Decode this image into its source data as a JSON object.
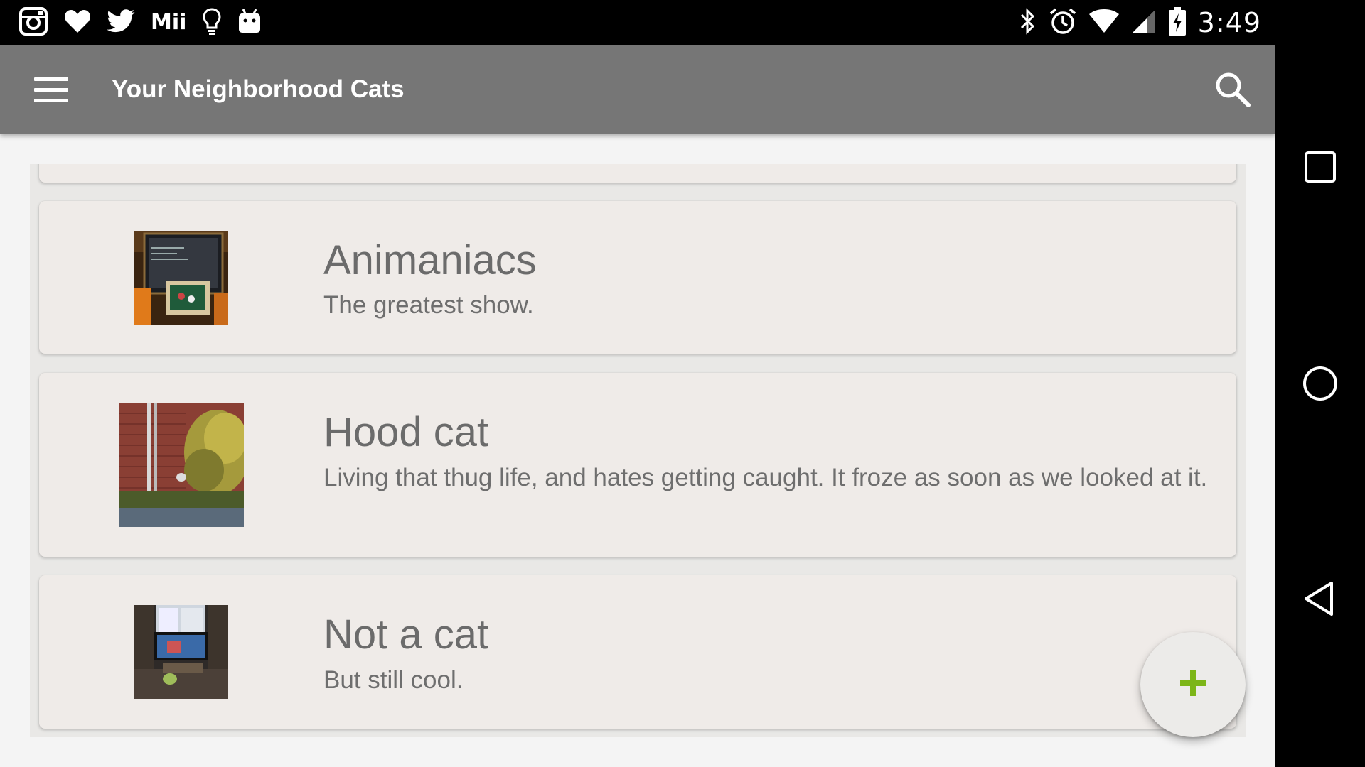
{
  "status_bar": {
    "left_icons": [
      "instagram-icon",
      "heart-icon",
      "twitter-icon",
      "mii-icon",
      "lightbulb-icon",
      "android-icon"
    ],
    "mii_label": "Mii",
    "right_icons": [
      "bluetooth-icon",
      "alarm-icon",
      "wifi-icon",
      "signal-icon",
      "battery-charging-icon"
    ],
    "time": "3:49"
  },
  "app_bar": {
    "title": "Your Neighborhood Cats",
    "background": "#767676"
  },
  "cats": [
    {
      "title": "Animaniacs",
      "description": "The greatest show."
    },
    {
      "title": "Hood cat",
      "description": "Living that thug life, and hates getting caught. It froze as soon as we looked at it."
    },
    {
      "title": "Not a cat",
      "description": "But still cool."
    }
  ],
  "fab": {
    "icon": "plus-icon",
    "accent": "#7cb518"
  },
  "nav_bar": {
    "buttons": [
      "recents-icon",
      "home-icon",
      "back-icon"
    ]
  }
}
